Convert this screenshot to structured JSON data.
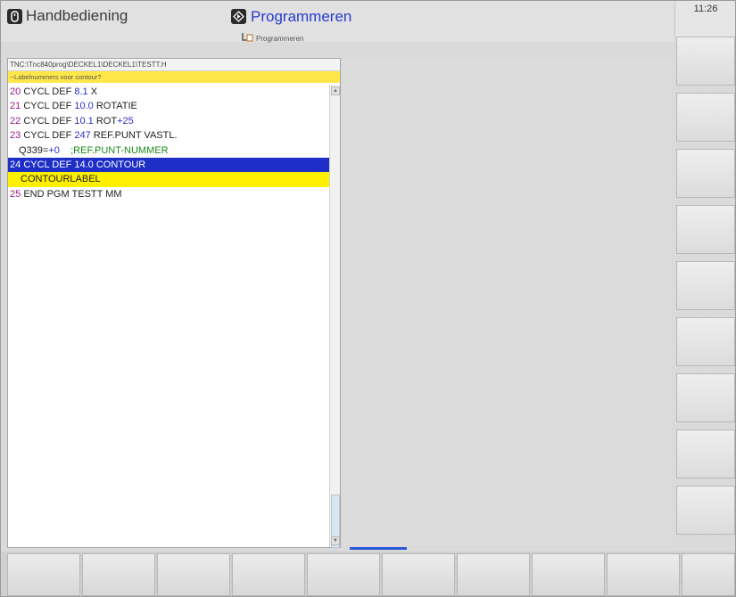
{
  "header": {
    "manual_title": "Handbediening",
    "prog_title": "Programmeren",
    "prog_subtitle": "Programmeren",
    "clock": "11:26"
  },
  "program": {
    "path": "TNC:\\Tnc840prog\\DECKEL1\\DECKEL1\\TESTT.H",
    "prompt": "--Labelnummers voor contour?",
    "lines": [
      {
        "num": "20",
        "cmd": "CYCL DEF",
        "arg": "8.1",
        "rest": " X"
      },
      {
        "num": "21",
        "cmd": "CYCL DEF",
        "arg": "10.0",
        "rest": " ROTATIE"
      },
      {
        "num": "22",
        "cmd": "CYCL DEF",
        "arg": "10.1",
        "rest": " ROT",
        "val": "+25"
      },
      {
        "num": "23",
        "cmd": "CYCL DEF",
        "arg": "247",
        "rest": " REF.PUNT VASTL."
      },
      {
        "param": "Q339=",
        "pval": "+0",
        "comment": ";REF.PUNT-NUMMER"
      },
      {
        "num": "24",
        "full": "CYCL DEF 14.0 CONTOUR"
      },
      {
        "label": "CONTOURLABEL"
      },
      {
        "num": "25",
        "cmd": "END PGM TESTT MM"
      }
    ]
  },
  "icons": {
    "manual": "hand-wheel-icon",
    "program": "program-arrow-icon",
    "subprog": "file-tree-icon"
  },
  "colors": {
    "selection": "#1d2fc6",
    "input": "#ffef00",
    "prompt": "#ffe74a"
  }
}
